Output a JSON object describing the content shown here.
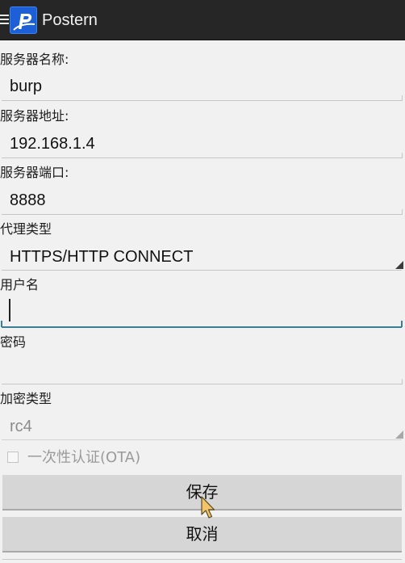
{
  "app": {
    "title": "Postern",
    "logo_letter": "P",
    "brand_color": "#1d5fd6"
  },
  "icons": {
    "menu": "hamburger-menu-icon",
    "logo": "postern-app-logo-icon",
    "spinner": "spinner-dropdown-triangle-icon",
    "cursor": "mouse-pointer-icon"
  },
  "form": {
    "server_name": {
      "label": "服务器名称:",
      "value": "burp"
    },
    "server_address": {
      "label": "服务器地址:",
      "value": "192.168.1.4"
    },
    "server_port": {
      "label": "服务器端口:",
      "value": "8888"
    },
    "proxy_type": {
      "label": "代理类型",
      "value": "HTTPS/HTTP CONNECT"
    },
    "username": {
      "label": "用户名",
      "value": ""
    },
    "password": {
      "label": "密码",
      "value": ""
    },
    "encryption_type": {
      "label": "加密类型",
      "value": "rc4"
    },
    "ota": {
      "label": "一次性认证(OTA)",
      "checked": false
    }
  },
  "buttons": {
    "save": "保存",
    "cancel": "取消"
  }
}
